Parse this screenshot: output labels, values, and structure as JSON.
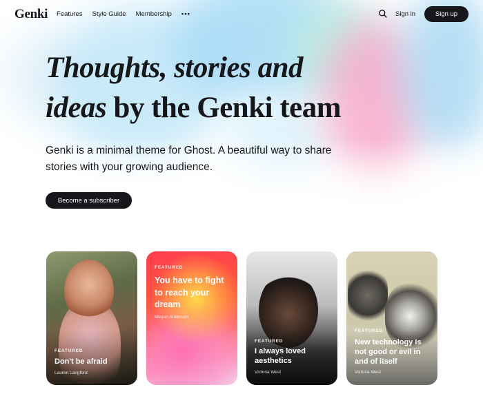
{
  "header": {
    "logo": "Genki",
    "nav": [
      "Features",
      "Style Guide",
      "Membership"
    ],
    "more": "•••",
    "signin": "Sign in",
    "signup": "Sign up"
  },
  "hero": {
    "line1": "Thoughts, stories and",
    "line2_italic": "ideas",
    "line2_rest": " by the Genki team",
    "subtitle": "Genki is a minimal theme for Ghost. A beautiful way to share stories with your growing audience.",
    "cta": "Become a subscriber"
  },
  "featured": [
    {
      "tag": "FEATURED",
      "title": "Don't be afraid",
      "author": "Lauren Langford"
    },
    {
      "tag": "FEATURED",
      "title": "You have to fight to reach your dream",
      "author": "Megan Anderson"
    },
    {
      "tag": "FEATURED",
      "title": "I always loved aesthetics",
      "author": "Victoria West"
    },
    {
      "tag": "FEATURED",
      "title": "New technology is not good or evil in and of itself",
      "author": "Victoria West"
    }
  ],
  "colors": {
    "text": "#15171a",
    "button": "#15171a",
    "background": "#ffffff"
  },
  "icons": {
    "search": "search-icon",
    "more": "more-icon"
  }
}
